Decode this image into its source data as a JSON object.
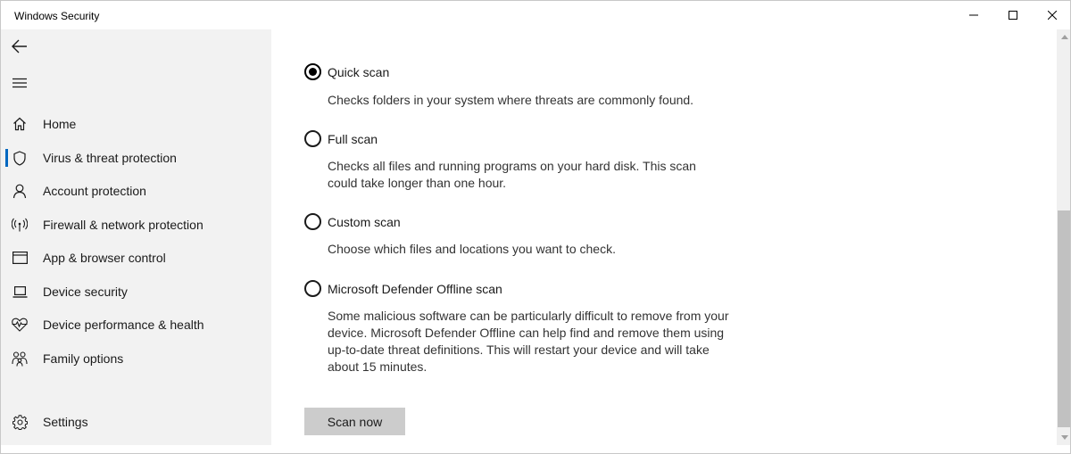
{
  "window": {
    "title": "Windows Security",
    "controls": {
      "minimize": "minimize-icon",
      "maximize": "maximize-icon",
      "close": "close-icon"
    }
  },
  "sidebar": {
    "back_icon": "back-arrow-icon",
    "menu_icon": "hamburger-menu-icon",
    "items": [
      {
        "label": "Home",
        "icon": "home-icon"
      },
      {
        "label": "Virus & threat protection",
        "icon": "shield-icon",
        "selected": true
      },
      {
        "label": "Account protection",
        "icon": "person-icon"
      },
      {
        "label": "Firewall & network protection",
        "icon": "wifi-antenna-icon"
      },
      {
        "label": "App & browser control",
        "icon": "browser-window-icon"
      },
      {
        "label": "Device security",
        "icon": "laptop-icon"
      },
      {
        "label": "Device performance & health",
        "icon": "heart-pulse-icon"
      },
      {
        "label": "Family options",
        "icon": "family-icon"
      }
    ],
    "settings": {
      "label": "Settings",
      "icon": "gear-icon"
    }
  },
  "scan_options": [
    {
      "label": "Quick scan",
      "checked": true,
      "description": "Checks folders in your system where threats are commonly found."
    },
    {
      "label": "Full scan",
      "checked": false,
      "description": "Checks all files and running programs on your hard disk. This scan could take longer than one hour."
    },
    {
      "label": "Custom scan",
      "checked": false,
      "description": "Choose which files and locations you want to check."
    },
    {
      "label": "Microsoft Defender Offline scan",
      "checked": false,
      "description": "Some malicious software can be particularly difficult to remove from your device. Microsoft Defender Offline can help find and remove them using up-to-date threat definitions. This will restart your device and will take about 15 minutes."
    }
  ],
  "scan_button": {
    "label": "Scan now"
  },
  "colors": {
    "accent": "#0067c0",
    "sidebar_bg": "#f2f2f2",
    "button_bg": "#cccccc"
  }
}
